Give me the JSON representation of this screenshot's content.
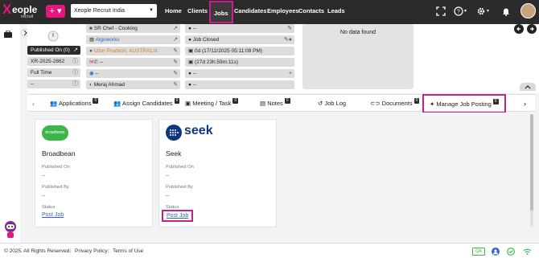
{
  "header": {
    "logo_x": "X",
    "logo_rest": "eople",
    "logo_sub": "recruit",
    "plus": "+ ▾",
    "company": "Xeople Recruit India",
    "nav": [
      "Home",
      "Clients",
      "Jobs",
      "Candidates",
      "Employees",
      "Contacts",
      "Leads"
    ],
    "icons": [
      "fullscreen-icon",
      "help-icon",
      "settings-icon",
      "bell-icon"
    ],
    "help_caret": "▾",
    "settings_caret": "▾"
  },
  "job_panel": {
    "published": "Published On (0)",
    "job_id": "XR-2025-2862",
    "type": "Full Time",
    "dash": "--",
    "title": "SR Chef - Cooking",
    "client": "Algoworks",
    "location": "Uttar Pradesh, AUSTRALIA",
    "dash2": "--",
    "dash3": "--",
    "owner": "Meraj Ahmad",
    "status_dash": "--",
    "status": "Job Closed",
    "date": "0d (17/12/2025 05:11:09 PM)",
    "duration": "(27d 23h:59m:11s)",
    "dash4": "--",
    "dash5": "--"
  },
  "no_data": "No data found",
  "tabs": [
    {
      "label": "Applications",
      "badge": "0"
    },
    {
      "label": "Assign Candidates",
      "badge": "0"
    },
    {
      "label": "Meeting / Task",
      "badge": "0"
    },
    {
      "label": "Notes",
      "badge": "0"
    },
    {
      "label": "Job Log",
      "badge": ""
    },
    {
      "label": "Documents",
      "badge": "0"
    },
    {
      "label": "Manage Job Posting",
      "badge": "0"
    }
  ],
  "cards": [
    {
      "logo": "broadbean",
      "name": "Broadbean",
      "published_on_label": "Published On",
      "published_on": "--",
      "published_by_label": "Published By",
      "published_by": "--",
      "status_label": "Status",
      "action": "Post Job"
    },
    {
      "logo": "seek",
      "name": "Seek",
      "published_on_label": "Published On",
      "published_on": "--",
      "published_by_label": "Published By",
      "published_by": "--",
      "status_label": "Status",
      "action": "Post Job"
    }
  ],
  "footer": {
    "copyright": "© 2025. All Rights Reserved",
    "privacy": "Privacy Policy",
    "terms": "Terms of Use",
    "qa": "QA"
  },
  "colors": {
    "brand": "#e7157c",
    "highlight": "#c81f8e",
    "dark": "#2b2b2b",
    "link": "#3563c5"
  }
}
